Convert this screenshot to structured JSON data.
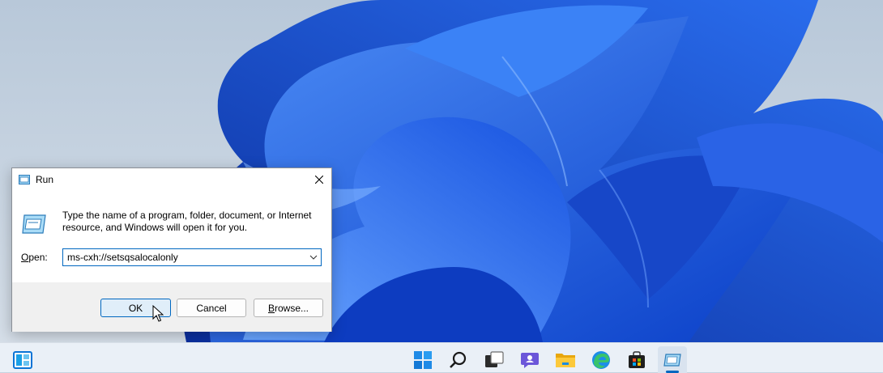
{
  "window": {
    "title": "Run",
    "description": "Type the name of a program, folder, document, or Internet resource, and Windows will open it for you.",
    "open_label_accel": "O",
    "open_label_rest": "pen:",
    "open_value": "ms-cxh://setsqsalocalonly"
  },
  "buttons": {
    "ok": "OK",
    "cancel": "Cancel",
    "browse_accel": "B",
    "browse_rest": "rowse..."
  },
  "taskbar": {
    "items": [
      "widgets-icon",
      "start-icon",
      "search-icon",
      "task-view-icon",
      "chat-icon",
      "file-explorer-icon",
      "edge-icon",
      "store-icon",
      "run-icon"
    ]
  },
  "colors": {
    "accent": "#0067c0",
    "wallpaper_blue": "#1a5de8",
    "wallpaper_bg": "#c6d3e0"
  }
}
